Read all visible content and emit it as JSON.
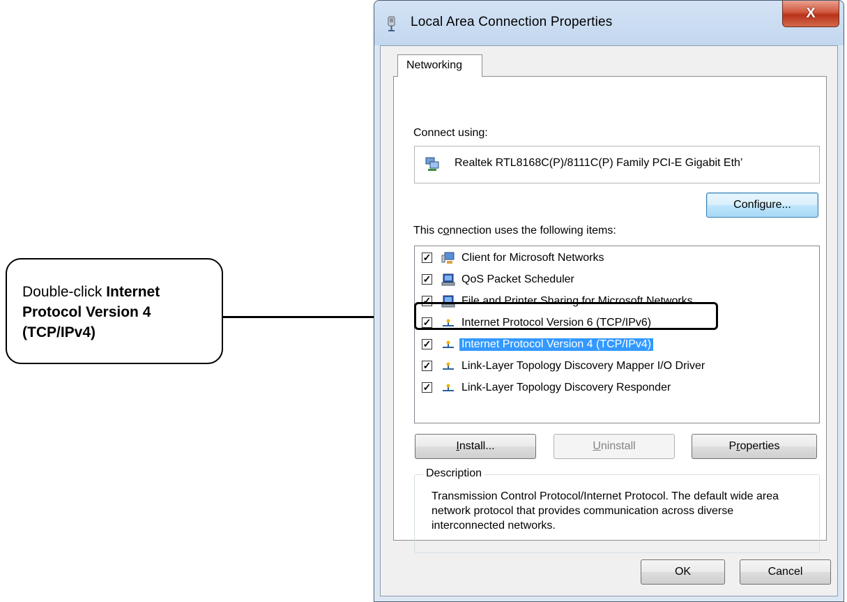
{
  "callout": {
    "prefix": "Double-click ",
    "bold": "Internet Protocol Version 4 (TCP/IPv4)"
  },
  "window": {
    "title": "Local Area Connection Properties",
    "close_label": "X"
  },
  "tabs": [
    {
      "label": "Networking",
      "active": true
    }
  ],
  "connect_using": {
    "label": "Connect using:",
    "adapter": "Realtek RTL8168C(P)/8111C(P) Family PCI-E Gigabit Eth’",
    "configure_button": "Configure..."
  },
  "items_section": {
    "label_pre": "This c",
    "label_u": "o",
    "label_post": "nnection uses the following items:",
    "items": [
      {
        "label": "Client for Microsoft Networks",
        "checked": true,
        "icon": "network-client-icon"
      },
      {
        "label": "QoS Packet Scheduler",
        "checked": true,
        "icon": "computer-service-icon"
      },
      {
        "label": "File and Printer Sharing for Microsoft Networks",
        "checked": true,
        "icon": "computer-service-icon"
      },
      {
        "label": "Internet Protocol Version 6 (TCP/IPv6)",
        "checked": true,
        "icon": "protocol-icon"
      },
      {
        "label": "Internet Protocol Version 4 (TCP/IPv4)",
        "checked": true,
        "icon": "protocol-icon",
        "selected": true
      },
      {
        "label": "Link-Layer Topology Discovery Mapper I/O Driver",
        "checked": true,
        "icon": "protocol-icon"
      },
      {
        "label": "Link-Layer Topology Discovery Responder",
        "checked": true,
        "icon": "protocol-icon"
      }
    ]
  },
  "buttons": {
    "install_u": "I",
    "install_rest": "nstall...",
    "uninstall_u": "U",
    "uninstall_rest": "ninstall",
    "properties_pre": "P",
    "properties_u": "r",
    "properties_rest": "operties",
    "ok": "OK",
    "cancel": "Cancel"
  },
  "description": {
    "title": "Description",
    "text": "Transmission Control Protocol/Internet Protocol. The default wide area network protocol that provides communication across diverse interconnected networks."
  },
  "colors": {
    "selection": "#3399ff",
    "window_frame": "#dbe6f3",
    "close_button": "#c84a30"
  }
}
